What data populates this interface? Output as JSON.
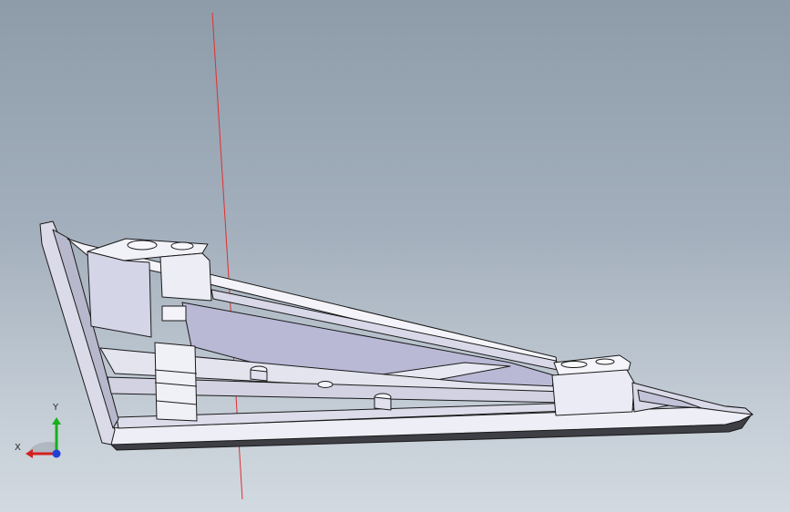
{
  "view": {
    "background_top": "#8e9caa",
    "background_bottom": "#d2d9e0",
    "section_line_color": "#e03030"
  },
  "triad": {
    "x_label": "X",
    "y_label": "Y",
    "x_color": "#d42020",
    "y_color": "#18b018",
    "z_color": "#2040d8"
  },
  "model": {
    "part_fill": "#eeeef6",
    "part_shadow": "#c9c9dc",
    "part_edge": "#1a1a1a",
    "inner_floor": "#b9b9d6",
    "underside": "#3e3e45"
  }
}
